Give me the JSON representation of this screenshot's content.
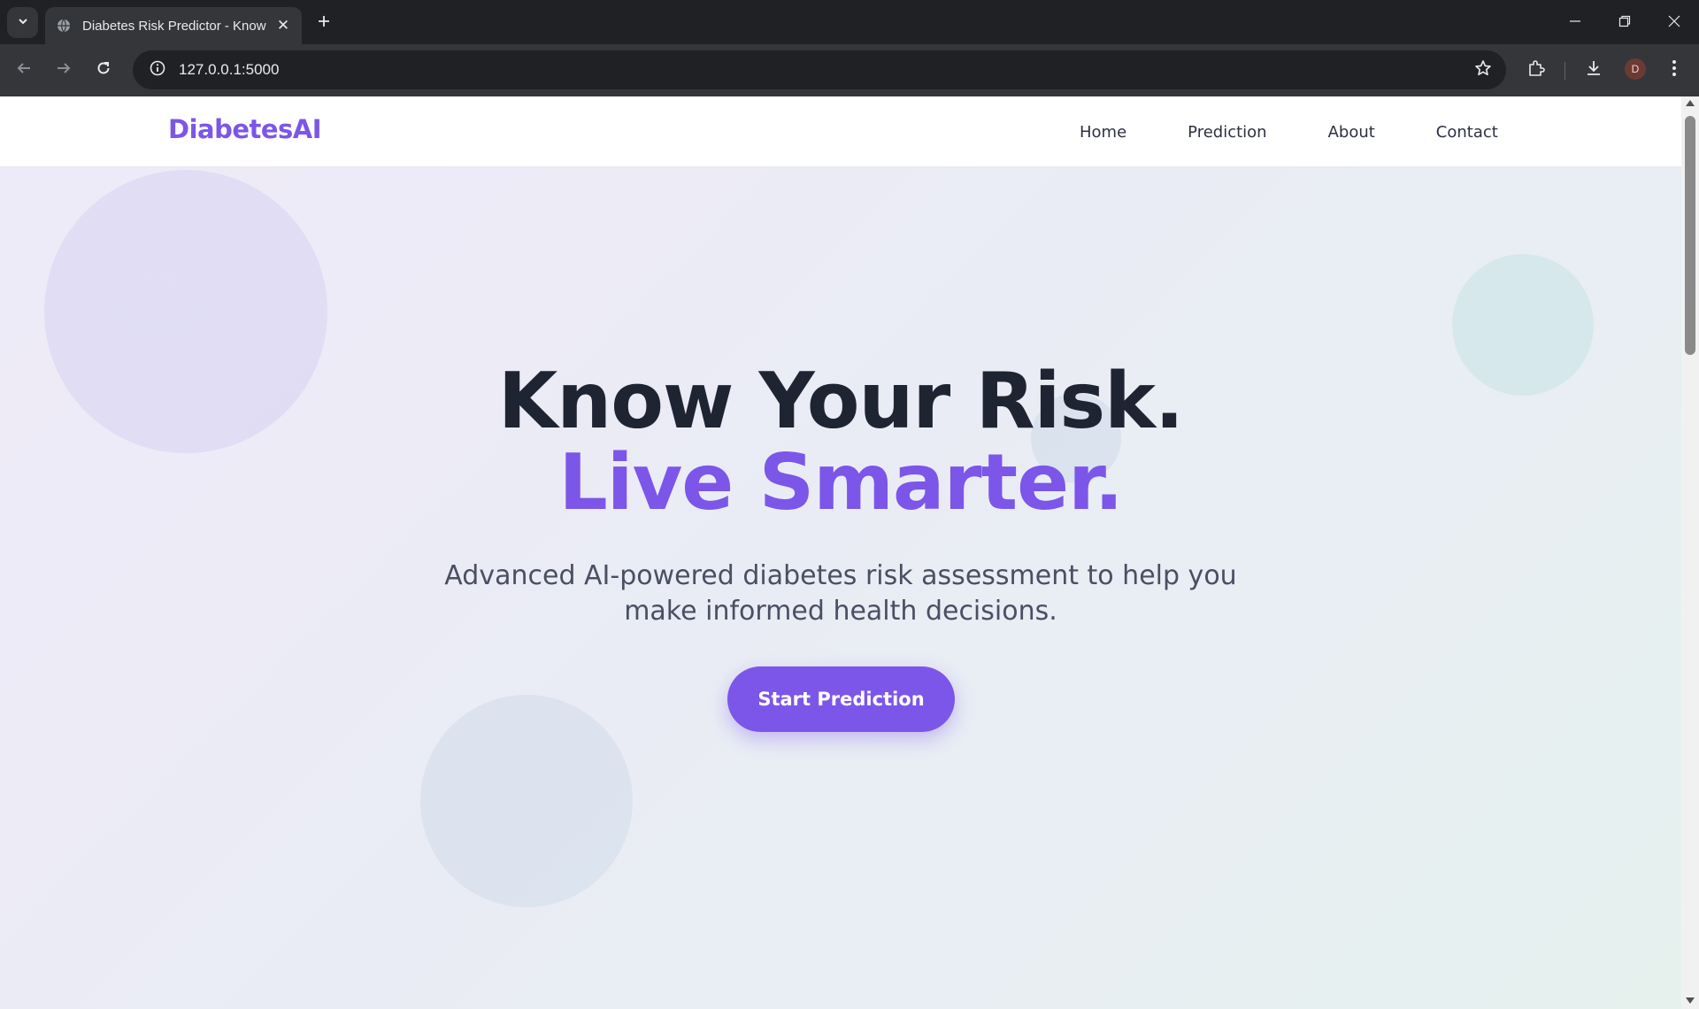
{
  "browser": {
    "tab_title": "Diabetes Risk Predictor - Know",
    "url": "127.0.0.1:5000",
    "profile_initial": "D"
  },
  "site": {
    "logo": "DiabetesAI",
    "nav": [
      {
        "label": "Home"
      },
      {
        "label": "Prediction"
      },
      {
        "label": "About"
      },
      {
        "label": "Contact"
      }
    ]
  },
  "hero": {
    "title": "Know Your Risk.",
    "subtitle": "Live Smarter.",
    "description": "Advanced AI-powered diabetes risk assessment to help you make informed health decisions.",
    "cta_label": "Start Prediction"
  },
  "colors": {
    "brand": "#7c56e8",
    "heading": "#1f2433",
    "body_text": "#4a4f63"
  },
  "icons": [
    "tab-list-icon",
    "globe-favicon-icon",
    "close-icon",
    "plus-icon",
    "minimize-icon",
    "restore-icon",
    "window-close-icon",
    "back-icon",
    "forward-icon",
    "reload-icon",
    "site-info-icon",
    "star-icon",
    "extensions-icon",
    "download-icon",
    "more-menu-icon"
  ]
}
